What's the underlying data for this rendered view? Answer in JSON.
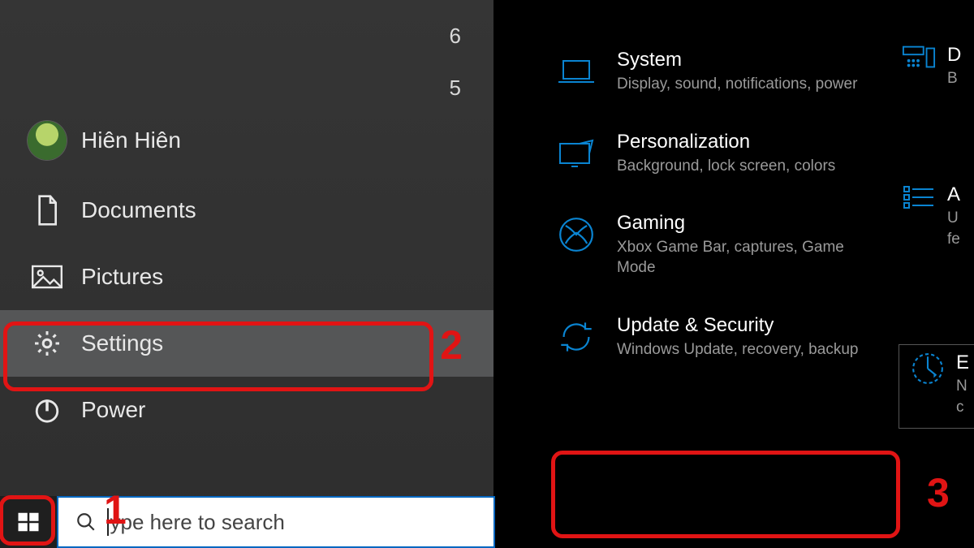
{
  "vague_overlay": {
    "top": "6",
    "below": "5"
  },
  "start_menu": {
    "user_name": "Hiên Hiên",
    "items": [
      {
        "id": "documents",
        "label": "Documents"
      },
      {
        "id": "pictures",
        "label": "Pictures"
      },
      {
        "id": "settings",
        "label": "Settings"
      },
      {
        "id": "power",
        "label": "Power"
      }
    ]
  },
  "taskbar": {
    "search_placeholder": "Type here to search",
    "search_display_prefix": "t",
    "search_display_suffix": "ype here to search"
  },
  "settings_tiles": [
    {
      "id": "system",
      "title": "System",
      "sub": "Display, sound, notifications, power"
    },
    {
      "id": "personalization",
      "title": "Personalization",
      "sub": "Background, lock screen, colors"
    },
    {
      "id": "gaming",
      "title": "Gaming",
      "sub": "Xbox Game Bar, captures, Game Mode"
    },
    {
      "id": "update",
      "title": "Update & Security",
      "sub": "Windows Update, recovery, backup"
    }
  ],
  "settings_tiles_partial": [
    {
      "id": "devices",
      "title_fragment": "D",
      "sub_fragment": "B"
    },
    {
      "id": "apps",
      "title_fragment": "A",
      "sub_fragment": "U",
      "sub_fragment2": "fe"
    },
    {
      "id": "ease",
      "title_fragment": "E",
      "sub_fragment": "N",
      "sub_fragment2": "c"
    }
  ],
  "annotations": {
    "step1": "1",
    "step2": "2",
    "step3": "3"
  },
  "colors": {
    "accent_blue": "#0a84d1",
    "highlight_red": "#e11414"
  }
}
